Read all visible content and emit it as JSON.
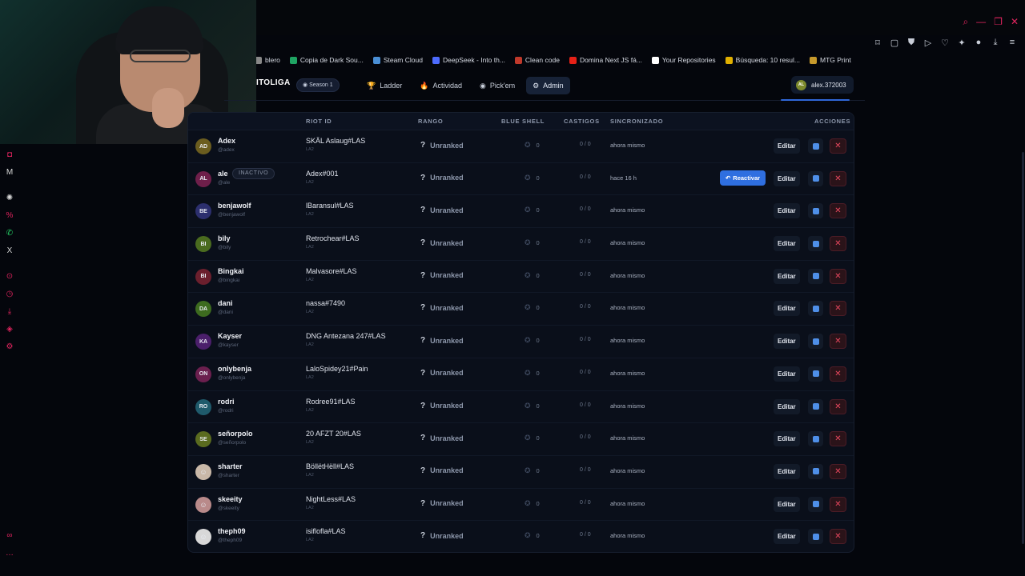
{
  "bookmarks": [
    {
      "label": "blero",
      "color": "#888888"
    },
    {
      "label": "Copia de Dark Sou...",
      "color": "#1fa463"
    },
    {
      "label": "Steam Cloud",
      "color": "#4a8fd6"
    },
    {
      "label": "DeepSeek - Into th...",
      "color": "#4d6bfe"
    },
    {
      "label": "Clean code",
      "color": "#c0392b"
    },
    {
      "label": "Domina Next JS fá...",
      "color": "#e62117"
    },
    {
      "label": "Your Repositories",
      "color": "#ffffff"
    },
    {
      "label": "Búsqueda: 10 resul...",
      "color": "#e1b000"
    },
    {
      "label": "MTG Print",
      "color": "#c79a2c"
    }
  ],
  "header": {
    "logo": "ITOLIGA",
    "season": "Season 1",
    "tabs": [
      {
        "label": "Ladder",
        "icon": "trophy-icon",
        "glyph": "🏆",
        "active": false
      },
      {
        "label": "Actividad",
        "icon": "fire-icon",
        "glyph": "🔥",
        "active": false
      },
      {
        "label": "Pick'em",
        "icon": "target-icon",
        "glyph": "◉",
        "active": false
      },
      {
        "label": "Admin",
        "icon": "gear-icon",
        "glyph": "⚙",
        "active": true
      }
    ],
    "user": {
      "initials": "AL",
      "name": "alex.372003"
    }
  },
  "table": {
    "columns": {
      "riot_id": "RIOT ID",
      "rango": "RANGO",
      "blue_shell": "BLUE SHELL",
      "castigos": "CASTIGOS",
      "sincronizado": "SINCRONIZADO",
      "acciones": "ACCIONES"
    },
    "buttons": {
      "edit": "Editar",
      "reactivate": "Reactivar"
    },
    "rows": [
      {
        "initials": "AD",
        "avatar_color": "#6b5d1f",
        "name": "Adex",
        "handle": "@adex",
        "riot": "SKÄL Aslaug#LAS",
        "region": "LA2",
        "rank": "Unranked",
        "shell": "0",
        "castigos": "0 / 0",
        "sync": "ahora mismo",
        "inactive": false,
        "badge": ""
      },
      {
        "initials": "AL",
        "avatar_color": "#6e1f4a",
        "name": "ale",
        "handle": "@ale",
        "riot": "Adex#001",
        "region": "LA2",
        "rank": "Unranked",
        "shell": "0",
        "castigos": "0 / 0",
        "sync": "hace 16 h",
        "inactive": true,
        "badge": "INACTIVO"
      },
      {
        "initials": "BE",
        "avatar_color": "#2c2f6e",
        "name": "benjawolf",
        "handle": "@benjawolf",
        "riot": "lBaransul#LAS",
        "region": "LA2",
        "rank": "Unranked",
        "shell": "0",
        "castigos": "0 / 0",
        "sync": "ahora mismo",
        "inactive": false,
        "badge": ""
      },
      {
        "initials": "BI",
        "avatar_color": "#4a6b1f",
        "name": "bily",
        "handle": "@bily",
        "riot": "Retrochear#LAS",
        "region": "LA2",
        "rank": "Unranked",
        "shell": "0",
        "castigos": "0 / 0",
        "sync": "ahora mismo",
        "inactive": false,
        "badge": ""
      },
      {
        "initials": "BI",
        "avatar_color": "#6b1f2d",
        "name": "Bingkai",
        "handle": "@bingkai",
        "riot": "Malvasore#LAS",
        "region": "LA2",
        "rank": "Unranked",
        "shell": "0",
        "castigos": "0 / 0",
        "sync": "ahora mismo",
        "inactive": false,
        "badge": ""
      },
      {
        "initials": "DA",
        "avatar_color": "#3d6b1f",
        "name": "dani",
        "handle": "@dani",
        "riot": "nassa#7490",
        "region": "LA2",
        "rank": "Unranked",
        "shell": "0",
        "castigos": "0 / 0",
        "sync": "ahora mismo",
        "inactive": false,
        "badge": ""
      },
      {
        "initials": "KA",
        "avatar_color": "#4b1f6b",
        "name": "Kayser",
        "handle": "@kayser",
        "riot": "DNG Antezana 247#LAS",
        "region": "LA2",
        "rank": "Unranked",
        "shell": "0",
        "castigos": "0 / 0",
        "sync": "ahora mismo",
        "inactive": false,
        "badge": ""
      },
      {
        "initials": "ON",
        "avatar_color": "#6b1f4e",
        "name": "onlybenja",
        "handle": "@onlybenja",
        "riot": "LaloSpidey21#Pain",
        "region": "LA2",
        "rank": "Unranked",
        "shell": "0",
        "castigos": "0 / 0",
        "sync": "ahora mismo",
        "inactive": false,
        "badge": ""
      },
      {
        "initials": "RO",
        "avatar_color": "#1f5a6b",
        "name": "rodri",
        "handle": "@rodri",
        "riot": "Rodree91#LAS",
        "region": "LA2",
        "rank": "Unranked",
        "shell": "0",
        "castigos": "0 / 0",
        "sync": "ahora mismo",
        "inactive": false,
        "badge": ""
      },
      {
        "initials": "SE",
        "avatar_color": "#5a6b1f",
        "name": "señorpolo",
        "handle": "@señorpolo",
        "riot": "20 AFZT 20#LAS",
        "region": "LA2",
        "rank": "Unranked",
        "shell": "0",
        "castigos": "0 / 0",
        "sync": "ahora mismo",
        "inactive": false,
        "badge": ""
      },
      {
        "initials": "",
        "avatar_color": "#c9b8a8",
        "name": "sharter",
        "handle": "@sharter",
        "riot": "BöllëtHëll#LAS",
        "region": "LA2",
        "rank": "Unranked",
        "shell": "0",
        "castigos": "0 / 0",
        "sync": "ahora mismo",
        "inactive": false,
        "badge": ""
      },
      {
        "initials": "",
        "avatar_color": "#b98a8a",
        "name": "skeeity",
        "handle": "@skeeity",
        "riot": "NightLess#LAS",
        "region": "LA2",
        "rank": "Unranked",
        "shell": "0",
        "castigos": "0 / 0",
        "sync": "ahora mismo",
        "inactive": false,
        "badge": ""
      },
      {
        "initials": "",
        "avatar_color": "#d8d8d8",
        "name": "theph09",
        "handle": "@theph09",
        "riot": "isiflofla#LAS",
        "region": "LA2",
        "rank": "Unranked",
        "shell": "0",
        "castigos": "0 / 0",
        "sync": "ahora mismo",
        "inactive": false,
        "badge": ""
      }
    ]
  },
  "colors": {
    "accent": "#2f6fe0",
    "danger": "#e8475e",
    "background": "#04060c"
  }
}
